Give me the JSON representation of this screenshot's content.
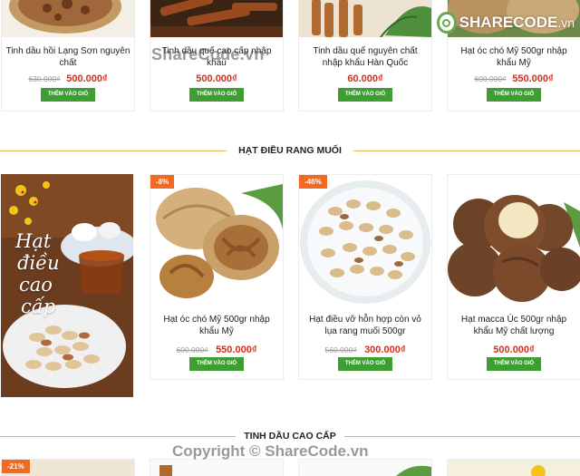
{
  "top_products": [
    {
      "name": "Tinh dầu hồi Lạng Sơn nguyên chất",
      "old_price": "630.000₫",
      "price": "500.000₫",
      "button": "THÊM VÀO GIỎ"
    },
    {
      "name": "Tinh dầu quế cao cấp nhập khẩu",
      "old_price": "",
      "price": "500.000₫",
      "button": "THÊM VÀO GIỎ"
    },
    {
      "name": "Tinh dầu quế nguyên chất nhập khẩu Hàn Quốc",
      "old_price": "",
      "price": "60.000₫",
      "button": "THÊM VÀO GIỎ"
    },
    {
      "name": "Hạt óc chó Mỹ 500gr nhập khẩu Mỹ",
      "old_price": "600.000₫",
      "price": "550.000₫",
      "button": "THÊM VÀO GIỎ"
    }
  ],
  "section_cashew": {
    "title": "HẠT ĐIỀU RANG MUỐI",
    "banner_text": [
      "Hạt",
      "điều",
      "cao",
      "cấp"
    ],
    "products": [
      {
        "badge": "-8%",
        "name": "Hạt óc chó Mỹ 500gr nhập khẩu Mỹ",
        "old_price": "600.000₫",
        "price": "550.000₫",
        "button": "THÊM VÀO GIỎ"
      },
      {
        "badge": "-46%",
        "name": "Hạt điều vỡ hỗn hợp còn vỏ lụa rang muối 500gr",
        "old_price": "560.000₫",
        "price": "300.000₫",
        "button": "THÊM VÀO GIỎ"
      },
      {
        "badge": "",
        "name": "Hạt macca Úc 500gr nhập khẩu Mỹ chất lượng",
        "old_price": "",
        "price": "500.000₫",
        "button": "THÊM VÀO GIỎ"
      }
    ]
  },
  "section_oil": {
    "title": "TINH DẦU CAO CẤP",
    "badge": "-21%"
  },
  "watermarks": {
    "top": "ShareCode.vn",
    "bottom": "Copyright © ShareCode.vn",
    "logo_share": "SHARE",
    "logo_code": "CODE",
    "logo_vn": ".vn"
  },
  "colors": {
    "button_green": "#3f9e33",
    "price_red": "#d32f1c",
    "badge_orange": "#f26a21",
    "section_line": "#e8b75a"
  }
}
